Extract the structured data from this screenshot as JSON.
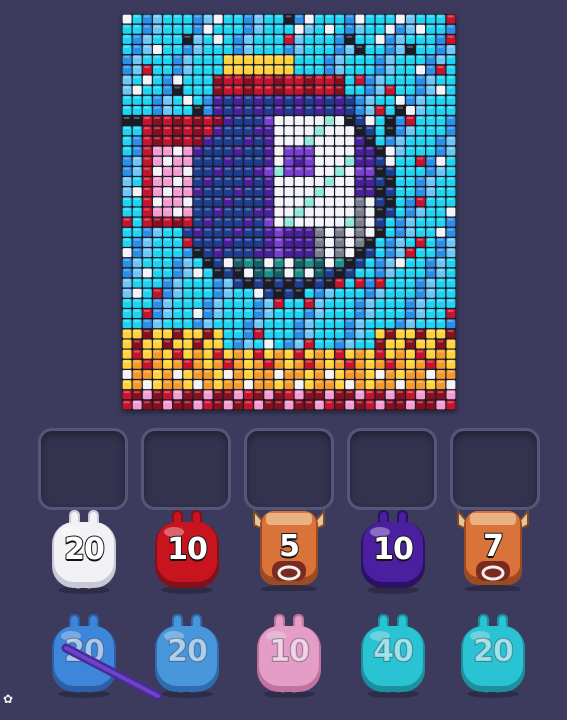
{
  "board": {
    "cols": 33,
    "rows": 39,
    "palette": {
      "cyan": "#1fd4f0",
      "blue": "#2a8fe6",
      "lightblue": "#6ec6f5",
      "navy": "#1e3d8f",
      "white": "#f4f4f8",
      "pink": "#f59ccf",
      "red": "#c8142b",
      "darkred": "#8a0f1e",
      "purple": "#4a1f9a",
      "violet": "#7a3fd0",
      "teal": "#1f8f8a",
      "darkteal": "#155f66",
      "black": "#1c1c24",
      "gray": "#7b7f8c",
      "yellow": "#ffd23c",
      "orange": "#f39a2a",
      "mint": "#8fe8d8"
    }
  },
  "slots": [
    {
      "state": "empty"
    },
    {
      "state": "empty"
    },
    {
      "state": "empty"
    },
    {
      "state": "empty"
    },
    {
      "state": "empty"
    }
  ],
  "queue_front": [
    {
      "kind": "pig",
      "color": "#f2f2f6",
      "shade": "#c9c9d6",
      "count": "20"
    },
    {
      "kind": "pig",
      "color": "#c8141f",
      "shade": "#86101a",
      "count": "10"
    },
    {
      "kind": "bull",
      "color": "#d9733a",
      "shade": "#9c4a22",
      "count": "5"
    },
    {
      "kind": "pig",
      "color": "#4a1fa0",
      "shade": "#2c1166",
      "count": "10"
    },
    {
      "kind": "bull",
      "color": "#d9733a",
      "shade": "#9c4a22",
      "count": "7"
    }
  ],
  "queue_back": [
    {
      "kind": "pig",
      "color": "#3f8fe8",
      "shade": "#2a63b0",
      "count": "20"
    },
    {
      "kind": "pig",
      "color": "#4aa2e8",
      "shade": "#2f72b8",
      "count": "20"
    },
    {
      "kind": "pig",
      "color": "#f7a8d3",
      "shade": "#d07aa8",
      "count": "10"
    },
    {
      "kind": "pig",
      "color": "#29d2e0",
      "shade": "#1a9aa8",
      "count": "40"
    },
    {
      "kind": "pig",
      "color": "#29d2e0",
      "shade": "#1a9aa8",
      "count": "20"
    }
  ]
}
